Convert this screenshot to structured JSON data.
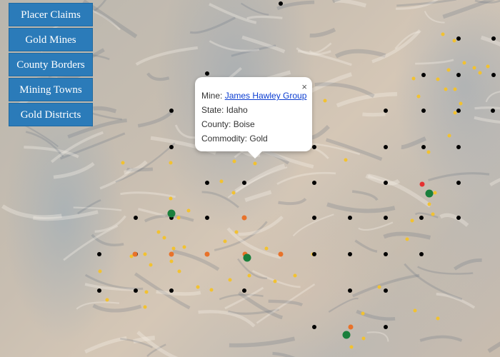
{
  "controls": {
    "buttons": [
      "Placer Claims",
      "Gold Mines",
      "County Borders",
      "Mining Towns",
      "Gold Districts"
    ]
  },
  "popup": {
    "mine_label": "Mine:",
    "mine_name": "James Hawley Group",
    "state_label": "State:",
    "state": "Idaho",
    "county_label": "County:",
    "county": "Boise",
    "commodity_label": "Commodity:",
    "commodity": "Gold",
    "close": "×"
  },
  "legend_colors": {
    "placer_claim": "#000000",
    "gold_mine": "#f2c230",
    "orange_marker": "#e8722a",
    "green_marker": "#1a7f3c",
    "red_marker": "#e53030"
  }
}
